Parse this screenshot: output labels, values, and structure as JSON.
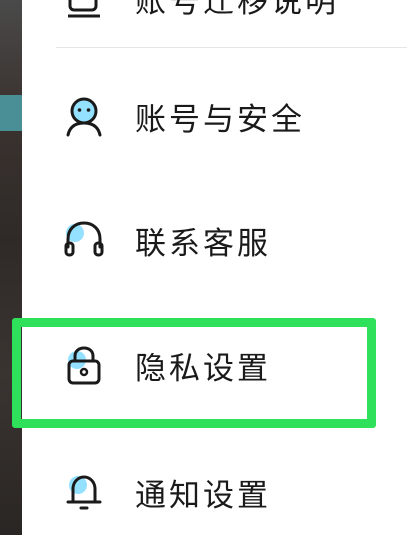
{
  "menu": {
    "items": [
      {
        "id": "partial",
        "label": "账号迁移说明",
        "icon": "document-icon"
      },
      {
        "id": "account",
        "label": "账号与安全",
        "icon": "user-icon"
      },
      {
        "id": "support",
        "label": "联系客服",
        "icon": "headset-icon"
      },
      {
        "id": "privacy",
        "label": "隐私设置",
        "icon": "lock-icon"
      },
      {
        "id": "notify",
        "label": "通知设置",
        "icon": "bell-icon"
      }
    ]
  },
  "highlight": {
    "target": "privacy",
    "color": "#2fe05a"
  },
  "colors": {
    "icon_stroke": "#1a1a1a",
    "icon_accent": "#3cc8ff",
    "text": "#1a1a1a"
  }
}
